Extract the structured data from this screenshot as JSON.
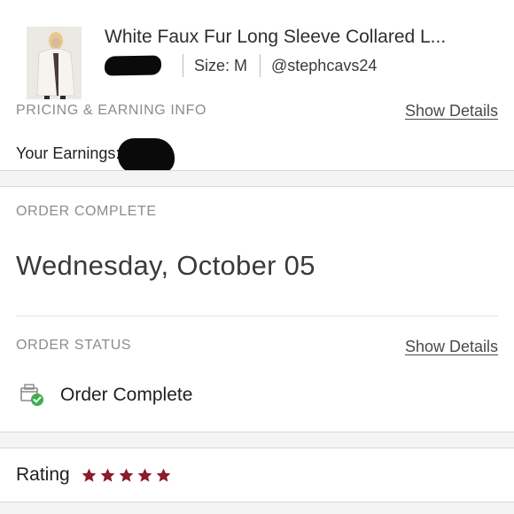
{
  "listing": {
    "title": "White Faux Fur Long Sleeve Collared L...",
    "size": "Size: M",
    "seller": "@stephcavs24",
    "thumbnail_icon": "coat-photo"
  },
  "pricing": {
    "section_label": "PRICING & EARNING INFO",
    "show_details": "Show Details",
    "earnings_label": "Your Earnings: "
  },
  "order": {
    "section_label": "ORDER COMPLETE",
    "date": "Wednesday, October 05"
  },
  "status": {
    "section_label": "ORDER STATUS",
    "show_details": "Show Details",
    "value": "Order Complete",
    "icon": "package-check-icon",
    "check_color": "#3db050"
  },
  "rating": {
    "label": "Rating",
    "stars": 5,
    "star_color": "#8a1c2b"
  }
}
